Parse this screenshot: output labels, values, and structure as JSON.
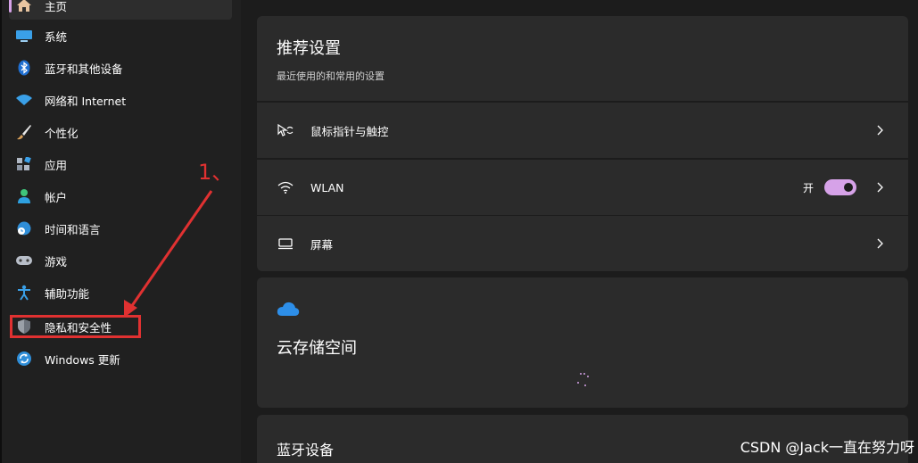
{
  "sidebar": {
    "items": [
      {
        "label": "主页",
        "icon": "home-icon"
      },
      {
        "label": "系统",
        "icon": "system-icon"
      },
      {
        "label": "蓝牙和其他设备",
        "icon": "bluetooth-icon"
      },
      {
        "label": "网络和 Internet",
        "icon": "wifi-icon"
      },
      {
        "label": "个性化",
        "icon": "brush-icon"
      },
      {
        "label": "应用",
        "icon": "apps-icon"
      },
      {
        "label": "帐户",
        "icon": "account-icon"
      },
      {
        "label": "时间和语言",
        "icon": "globe-clock-icon"
      },
      {
        "label": "游戏",
        "icon": "gamepad-icon"
      },
      {
        "label": "辅助功能",
        "icon": "accessibility-icon"
      },
      {
        "label": "隐私和安全性",
        "icon": "shield-icon"
      },
      {
        "label": "Windows 更新",
        "icon": "update-icon"
      }
    ],
    "accent_color": "#d6a2e8"
  },
  "recommended": {
    "title": "推荐设置",
    "subtitle": "最近使用的和常用的设置",
    "rows": [
      {
        "label": "鼠标指针与触控",
        "icon": "mouse-pointer-icon"
      },
      {
        "label": "WLAN",
        "icon": "wifi-icon",
        "toggle_label": "开",
        "toggle_on": true
      },
      {
        "label": "屏幕",
        "icon": "display-icon"
      }
    ]
  },
  "cloud": {
    "title": "云存储空间",
    "icon": "onedrive-cloud-icon"
  },
  "bluetooth": {
    "title": "蓝牙设备"
  },
  "annotation": {
    "label": "1、",
    "color": "#e03131"
  },
  "watermark": "CSDN @Jack一直在努力呀"
}
